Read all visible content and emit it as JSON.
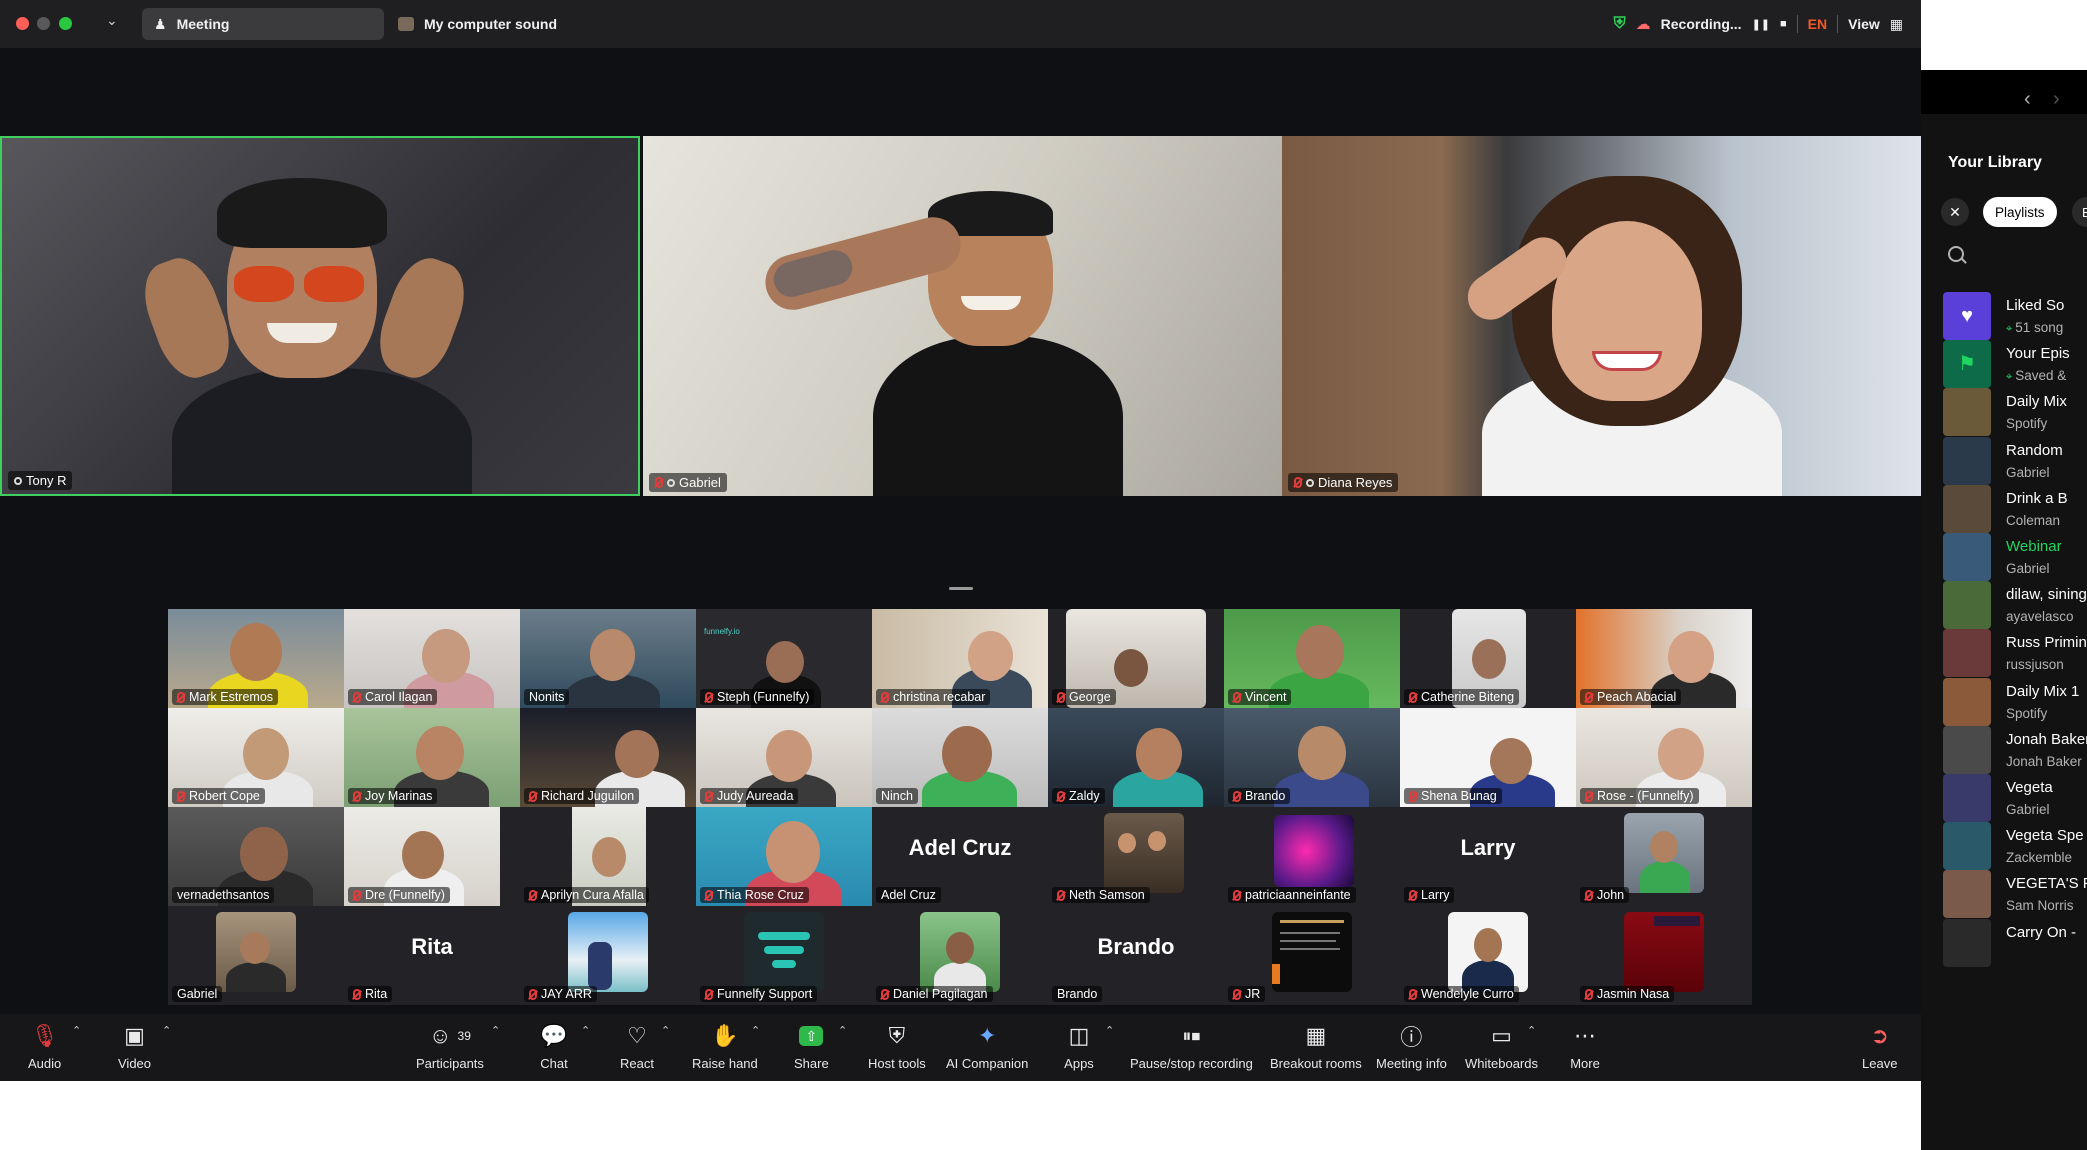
{
  "titlebar": {
    "meeting_tab": "Meeting",
    "sound_tab": "My computer sound",
    "recording": "Recording...",
    "language": "EN",
    "view": "View"
  },
  "speakers": [
    {
      "name": "Tony R"
    },
    {
      "name": "Gabriel"
    },
    {
      "name": "Diana Reyes"
    }
  ],
  "gallery": {
    "rows": [
      [
        "Mark Estremos",
        "Carol Ilagan",
        "Nonits",
        "Steph (Funnelfy)",
        "christina recabar",
        "George",
        "Vincent",
        "Catherine Biteng",
        "Peach Abacial"
      ],
      [
        "Robert Cope",
        "Joy Marinas",
        "Richard Juguilon",
        "Judy Aureada",
        "Ninch",
        "Zaldy",
        "Brando",
        "Shena Bunag",
        "Rose - (Funnelfy)"
      ],
      [
        "vernadethsantos",
        "Dre (Funnelfy)",
        "Aprilyn Cura Afalla",
        "Thia Rose Cruz",
        "Adel Cruz",
        "Neth Samson",
        "patriciaanneinfante",
        "Larry",
        "John"
      ],
      [
        "Gabriel",
        "Rita",
        "JAY ARR",
        "Funnelfy Support",
        "Daniel Pagilagan",
        "Brando",
        "JR",
        "Wendelyle Curro",
        "Jasmin Nasa"
      ]
    ],
    "no_video_big_names": {
      "adel": "Adel Cruz",
      "larry": "Larry",
      "rita": "Rita",
      "brando": "Brando"
    },
    "logo_text": "funnelfy.io"
  },
  "toolbar": {
    "audio": "Audio",
    "video": "Video",
    "participants_count": "39",
    "participants": "Participants",
    "chat": "Chat",
    "react": "React",
    "raise_hand": "Raise hand",
    "share": "Share",
    "host_tools": "Host tools",
    "ai_companion": "AI Companion",
    "apps": "Apps",
    "pause_stop": "Pause/stop recording",
    "breakout": "Breakout rooms",
    "meeting_info": "Meeting info",
    "whiteboards": "Whiteboards",
    "more": "More",
    "leave": "Leave"
  },
  "spotify": {
    "title": "Your Library",
    "chip": "Playlists",
    "chip2": "B",
    "items": [
      {
        "title": "Liked So",
        "sub": "51 song",
        "color": "#5b3fd9",
        "pinned": true
      },
      {
        "title": "Your Epis",
        "sub": "Saved &",
        "color": "#0d6b4a",
        "pinned": true
      },
      {
        "title": "Daily Mix",
        "sub": "Spotify",
        "color": "#6b5a3a",
        "pinned": false
      },
      {
        "title": "Random",
        "sub": "Gabriel",
        "color": "#2b3a4a",
        "pinned": false
      },
      {
        "title": "Drink a B",
        "sub": "Coleman",
        "color": "#5a4a3a",
        "pinned": false
      },
      {
        "title": "Webinar",
        "sub": "Gabriel",
        "color": "#3a5a7a",
        "pinned": false,
        "active": true
      },
      {
        "title": "dilaw, sining",
        "sub": "ayavelasco",
        "color": "#4a6a3a",
        "pinned": false
      },
      {
        "title": "Russ Primin",
        "sub": "russjuson",
        "color": "#6a3a3a",
        "pinned": false
      },
      {
        "title": "Daily Mix 1",
        "sub": "Spotify",
        "color": "#8a5a3a",
        "pinned": false
      },
      {
        "title": "Jonah Baker",
        "sub": "Jonah Baker",
        "color": "#4a4a4a",
        "pinned": false
      },
      {
        "title": "Vegeta",
        "sub": "Gabriel",
        "color": "#3a3a6a",
        "pinned": false
      },
      {
        "title": "Vegeta Spe",
        "sub": "Zackemble",
        "color": "#2a5a6a",
        "pinned": false
      },
      {
        "title": "VEGETA'S P",
        "sub": "Sam Norris",
        "color": "#7a5a4a",
        "pinned": false
      },
      {
        "title": "Carry On -",
        "sub": "",
        "color": "#2a2a2a",
        "pinned": false
      }
    ]
  },
  "colors": {
    "active_speaker_border": "#3ecf5e",
    "mute_red": "#e23b3b",
    "spotify_green": "#1ed760",
    "share_green": "#2fb94b"
  }
}
